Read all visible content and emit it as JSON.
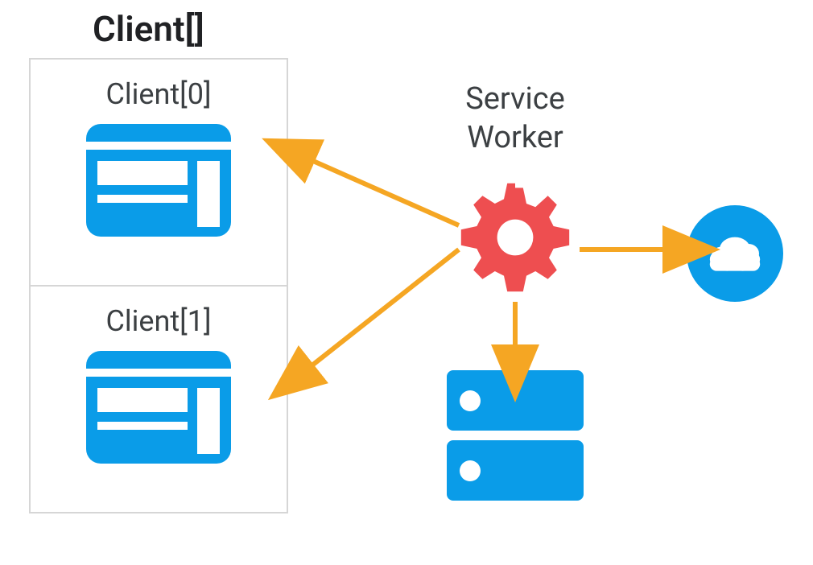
{
  "title": "Client[]",
  "clients": [
    {
      "label": "Client[0]"
    },
    {
      "label": "Client[1]"
    }
  ],
  "serviceWorker": {
    "label": "Service\nWorker"
  },
  "colors": {
    "blue": "#0a9ce8",
    "red": "#ee4e50",
    "orange": "#f5a623",
    "border": "#d6d6d6",
    "text": "#3c4043"
  },
  "components": {
    "gear": "service-worker-gear",
    "cloud": "cloud-network",
    "server": "server-storage",
    "windows": "browser-window"
  }
}
